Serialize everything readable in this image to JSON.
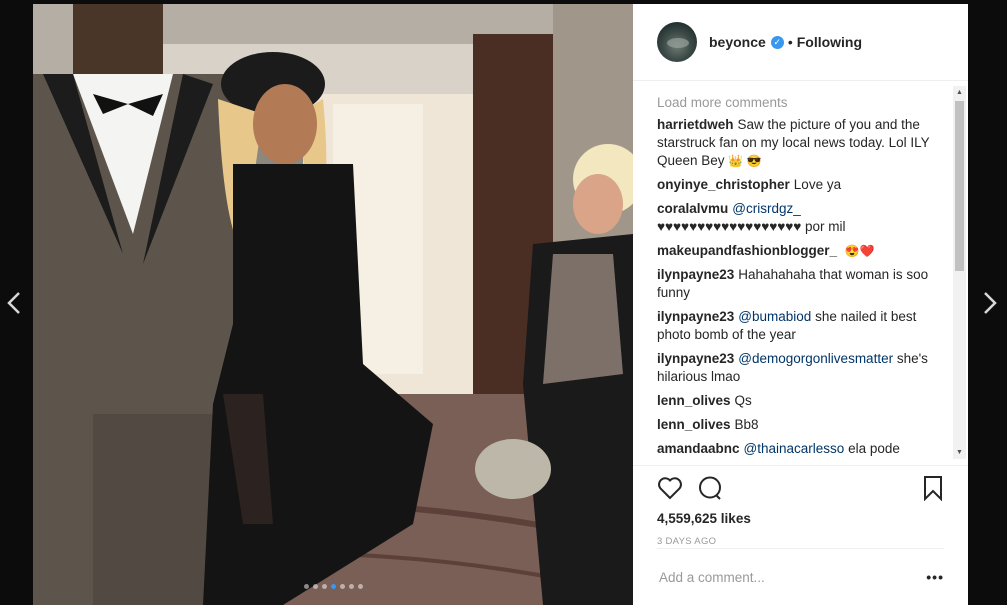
{
  "nav": {
    "prev_icon": "chevron-left-icon",
    "next_icon": "chevron-right-icon"
  },
  "post": {
    "carousel": {
      "count": 7,
      "active_index": 3
    },
    "header": {
      "username": "beyonce",
      "verified_icon": "verified-badge-icon",
      "separator": "•",
      "follow_label": "Following"
    },
    "load_more": "Load more comments",
    "comments": [
      {
        "user": "harrietdweh",
        "mention": "",
        "text": "Saw the picture of you and the starstruck fan on my local news today. Lol ILY Queen Bey",
        "emoji": "👑 😎"
      },
      {
        "user": "onyinye_christopher",
        "mention": "",
        "text": "Love ya",
        "emoji": ""
      },
      {
        "user": "coralalvmu",
        "mention": "@crisrdgz_",
        "text": "♥♥♥♥♥♥♥♥♥♥♥♥♥♥♥♥♥♥ por mil",
        "emoji": ""
      },
      {
        "user": "makeupandfashionblogger_",
        "mention": "",
        "text": "",
        "emoji": "😍❤️"
      },
      {
        "user": "ilynpayne23",
        "mention": "",
        "text": "Hahahahaha that woman is soo funny",
        "emoji": ""
      },
      {
        "user": "ilynpayne23",
        "mention": "@bumabiod",
        "text": "she nailed it best photo bomb of the year",
        "emoji": ""
      },
      {
        "user": "ilynpayne23",
        "mention": "@demogorgonlivesmatter",
        "text": "she's hilarious lmao",
        "emoji": ""
      },
      {
        "user": "lenn_olives",
        "mention": "",
        "text": "Qs",
        "emoji": ""
      },
      {
        "user": "lenn_olives",
        "mention": "",
        "text": "Bb8",
        "emoji": ""
      },
      {
        "user": "amandaabnc",
        "mention": "@thainacarlesso",
        "text": "ela pode",
        "emoji": ""
      }
    ],
    "actions": {
      "like_icon": "heart-icon",
      "comment_icon": "comment-icon",
      "save_icon": "bookmark-icon"
    },
    "likes": "4,559,625 likes",
    "time": "3 DAYS AGO",
    "add_comment_placeholder": "Add a comment...",
    "more_icon": "•••",
    "colors": {
      "accent": "#3897f0",
      "mention": "#003569",
      "muted": "#999999"
    }
  }
}
